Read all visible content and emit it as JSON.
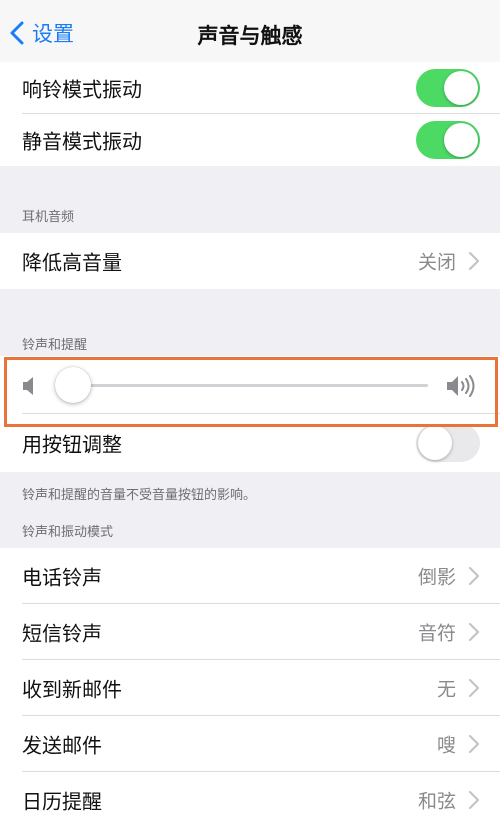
{
  "nav": {
    "back_label": "设置",
    "title": "声音与触感"
  },
  "vibration": {
    "ring_label": "响铃模式振动",
    "ring_on": true,
    "silent_label": "静音模式振动",
    "silent_on": true
  },
  "headphone": {
    "header": "耳机音频",
    "reduce_label": "降低高音量",
    "reduce_value": "关闭"
  },
  "ringer": {
    "header": "铃声和提醒",
    "volume_fraction": 0.04,
    "change_with_buttons_label": "用按钮调整",
    "change_with_buttons_on": false,
    "footnote": "铃声和提醒的音量不受音量按钮的影响。"
  },
  "patterns": {
    "header": "铃声和振动模式",
    "items": [
      {
        "label": "电话铃声",
        "value": "倒影"
      },
      {
        "label": "短信铃声",
        "value": "音符"
      },
      {
        "label": "收到新邮件",
        "value": "无"
      },
      {
        "label": "发送邮件",
        "value": "嗖"
      },
      {
        "label": "日历提醒",
        "value": "和弦"
      }
    ]
  },
  "colors": {
    "accent": "#1a7cf5",
    "toggle_on": "#4cd964",
    "highlight": "#e8743b"
  }
}
